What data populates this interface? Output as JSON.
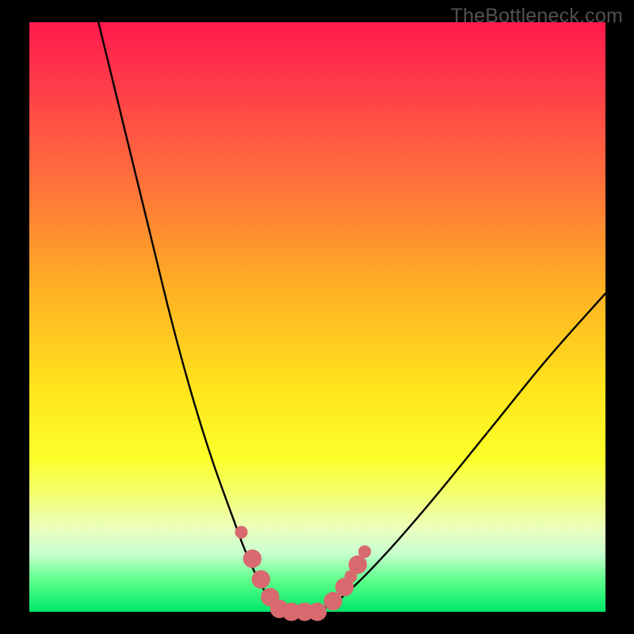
{
  "watermark": "TheBottleneck.com",
  "chart_data": {
    "type": "line",
    "title": "",
    "xlabel": "",
    "ylabel": "",
    "xlim": [
      0,
      100
    ],
    "ylim": [
      0,
      100
    ],
    "series": [
      {
        "name": "bottleneck-curve",
        "x": [
          12,
          14,
          16,
          18,
          20,
          22,
          24,
          26,
          28,
          30,
          32,
          34,
          35.5,
          37,
          38.5,
          40,
          41.5,
          43,
          45,
          48,
          52,
          56,
          62,
          70,
          80,
          90,
          100
        ],
        "values": [
          100,
          92,
          84,
          76,
          68,
          60,
          52,
          44.5,
          37.5,
          31,
          25,
          19.5,
          15.5,
          11.5,
          8,
          5,
          2.5,
          1,
          0,
          0,
          1,
          4,
          10,
          19,
          31,
          43,
          54
        ]
      }
    ],
    "markers": {
      "name": "highlight-dots",
      "color": "#d86a6f",
      "points": [
        {
          "x": 36.8,
          "y": 13.5,
          "r": 1.1
        },
        {
          "x": 38.7,
          "y": 9.0,
          "r": 1.6
        },
        {
          "x": 40.2,
          "y": 5.5,
          "r": 1.6
        },
        {
          "x": 41.8,
          "y": 2.5,
          "r": 1.6
        },
        {
          "x": 43.4,
          "y": 0.5,
          "r": 1.6
        },
        {
          "x": 45.5,
          "y": 0.0,
          "r": 1.6
        },
        {
          "x": 47.8,
          "y": 0.0,
          "r": 1.6
        },
        {
          "x": 50.0,
          "y": 0.0,
          "r": 1.6
        },
        {
          "x": 52.7,
          "y": 1.8,
          "r": 1.6
        },
        {
          "x": 54.7,
          "y": 4.2,
          "r": 1.6
        },
        {
          "x": 55.8,
          "y": 6.0,
          "r": 1.1
        },
        {
          "x": 57.0,
          "y": 8.0,
          "r": 1.6
        },
        {
          "x": 58.2,
          "y": 10.2,
          "r": 1.1
        }
      ]
    }
  }
}
